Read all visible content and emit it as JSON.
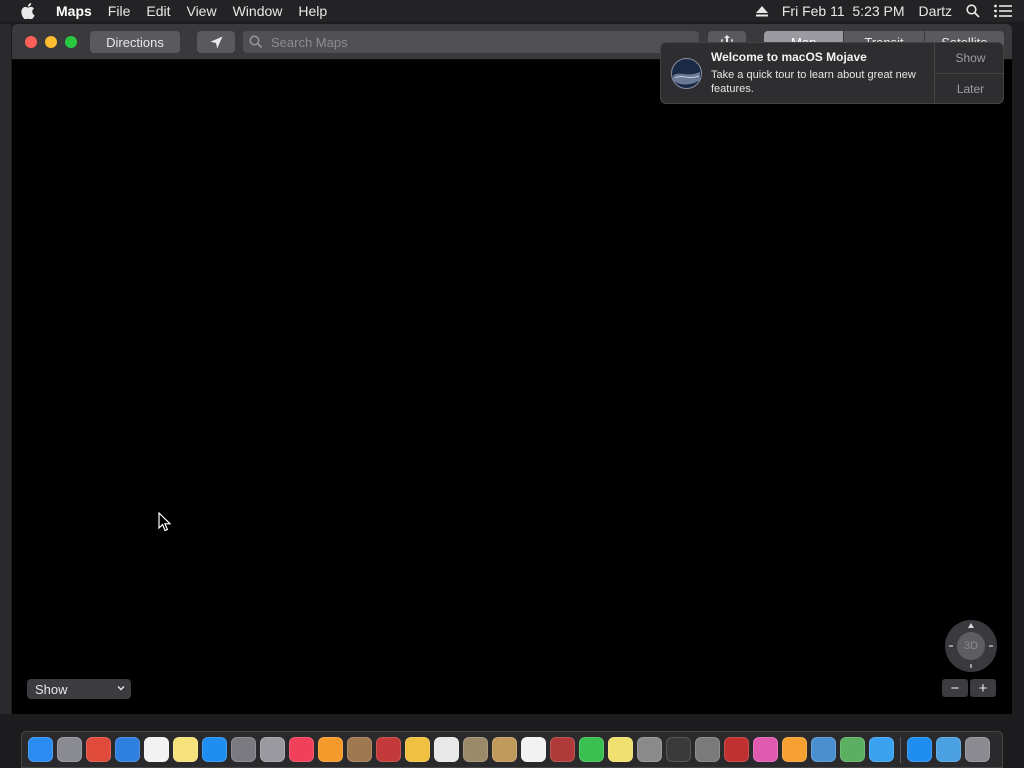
{
  "menubar": {
    "apple_icon": "apple-logo-icon",
    "app_name": "Maps",
    "menus": [
      "File",
      "Edit",
      "View",
      "Window",
      "Help"
    ],
    "eject_icon": "eject-icon",
    "clock": "Fri Feb 11  5:23 PM",
    "user": "Dartz",
    "spotlight_icon": "search-icon",
    "notification_icon": "notification-center-icon"
  },
  "toolbar": {
    "directions_label": "Directions",
    "location_icon": "location-arrow-icon",
    "search_placeholder": "Search Maps",
    "search_value": "",
    "share_icon": "share-icon",
    "map_modes": [
      "Map",
      "Transit",
      "Satellite"
    ],
    "selected_mode": "Map"
  },
  "notification": {
    "title": "Welcome to macOS Mojave",
    "body": "Take a quick tour to learn about great new features.",
    "show_label": "Show",
    "later_label": "Later",
    "icon": "mojave-icon"
  },
  "map": {
    "show_menu_label": "Show",
    "compass_label": "3D",
    "zoom_out_label": "−",
    "zoom_in_label": "+"
  },
  "dock": {
    "apps": [
      {
        "name": "finder-icon",
        "color": "#2a8cf0"
      },
      {
        "name": "launchpad-icon",
        "color": "#8a8a92"
      },
      {
        "name": "chrome-icon",
        "color": "#e04a3a"
      },
      {
        "name": "safari-icon",
        "color": "#2f7fe0"
      },
      {
        "name": "calendar-icon",
        "color": "#f2f2f2"
      },
      {
        "name": "notes-icon",
        "color": "#f5e27a"
      },
      {
        "name": "app-store-icon",
        "color": "#1f8ef0"
      },
      {
        "name": "system-preferences-icon",
        "color": "#7a7a80"
      },
      {
        "name": "script-editor-icon",
        "color": "#9a9aa0"
      },
      {
        "name": "news-icon",
        "color": "#f0405a"
      },
      {
        "name": "ibooks-icon",
        "color": "#f59a2a"
      },
      {
        "name": "preview-icon",
        "color": "#a07850"
      },
      {
        "name": "photo-booth-icon",
        "color": "#c43a3a"
      },
      {
        "name": "photos-icon",
        "color": "#f0c040"
      },
      {
        "name": "textedit-icon",
        "color": "#e8e8e8"
      },
      {
        "name": "automator-icon",
        "color": "#9a8a6a"
      },
      {
        "name": "contacts-icon",
        "color": "#c09a5a"
      },
      {
        "name": "reminders-icon",
        "color": "#f2f2f2"
      },
      {
        "name": "dictionary-icon",
        "color": "#b03a3a"
      },
      {
        "name": "facetime-icon",
        "color": "#3ac050"
      },
      {
        "name": "stickies-icon",
        "color": "#f0e070"
      },
      {
        "name": "font-book-icon",
        "color": "#8a8a8a"
      },
      {
        "name": "activity-monitor-icon",
        "color": "#3a3a3a"
      },
      {
        "name": "disk-utility-icon",
        "color": "#7a7a7a"
      },
      {
        "name": "system-information-icon",
        "color": "#c03030"
      },
      {
        "name": "itunes-icon",
        "color": "#e05ab0"
      },
      {
        "name": "home-icon",
        "color": "#f5a030"
      },
      {
        "name": "image-capture-icon",
        "color": "#4a90d0"
      },
      {
        "name": "maps-icon",
        "color": "#5ab060"
      },
      {
        "name": "messages-icon",
        "color": "#3aa0f0"
      }
    ],
    "right_apps": [
      {
        "name": "app-store-downloads-icon",
        "color": "#1f8ef0"
      },
      {
        "name": "applications-folder-icon",
        "color": "#4aa0e0"
      },
      {
        "name": "trash-icon",
        "color": "#8a8a90"
      }
    ]
  }
}
